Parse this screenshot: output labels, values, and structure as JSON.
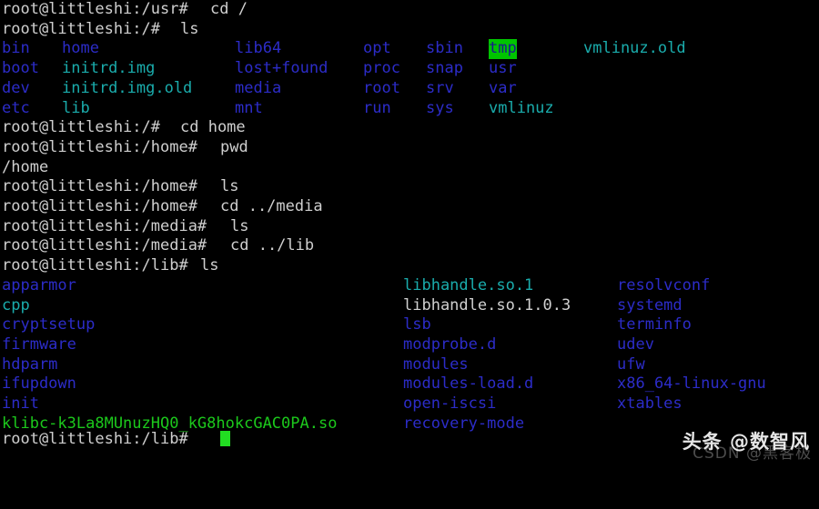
{
  "terminal": {
    "hostname": "littleshi",
    "user": "root",
    "background_color": "#000000",
    "palette": {
      "default": "#cfcfcf",
      "white_file": "#d0d0d0",
      "blue_dir": "#2c2cc8",
      "cyan_symlink": "#1aacac",
      "green_exec": "#1cc81c",
      "sticky_bg": "#00c400",
      "sticky_fg": "#1a1a8c",
      "cursor": "#22dd22"
    },
    "lines": [
      {
        "type": "prompt",
        "prompt": "root@littleshi:/usr# ",
        "command": "cd /"
      },
      {
        "type": "prompt",
        "prompt": "root@littleshi:/# ",
        "command": "ls"
      }
    ],
    "root_listing_rows": [
      [
        {
          "text": "bin",
          "color": "blue"
        },
        {
          "text": "home",
          "color": "blue"
        },
        {
          "text": "lib64",
          "color": "blue"
        },
        {
          "text": "opt",
          "color": "blue"
        },
        {
          "text": "sbin",
          "color": "blue"
        },
        {
          "text": "tmp",
          "color": "sticky"
        },
        {
          "text": "vmlinuz.old",
          "color": "cyan"
        }
      ],
      [
        {
          "text": "boot",
          "color": "blue"
        },
        {
          "text": "initrd.img",
          "color": "cyan"
        },
        {
          "text": "lost+found",
          "color": "blue"
        },
        {
          "text": "proc",
          "color": "blue"
        },
        {
          "text": "snap",
          "color": "blue"
        },
        {
          "text": "usr",
          "color": "blue"
        },
        {
          "text": "",
          "color": "blue"
        }
      ],
      [
        {
          "text": "dev",
          "color": "blue"
        },
        {
          "text": "initrd.img.old",
          "color": "cyan"
        },
        {
          "text": "media",
          "color": "blue"
        },
        {
          "text": "root",
          "color": "blue"
        },
        {
          "text": "srv",
          "color": "blue"
        },
        {
          "text": "var",
          "color": "blue"
        },
        {
          "text": "",
          "color": "blue"
        }
      ],
      [
        {
          "text": "etc",
          "color": "blue"
        },
        {
          "text": "lib",
          "color": "cyan"
        },
        {
          "text": "mnt",
          "color": "blue"
        },
        {
          "text": "run",
          "color": "blue"
        },
        {
          "text": "sys",
          "color": "blue"
        },
        {
          "text": "vmlinuz",
          "color": "cyan"
        },
        {
          "text": "",
          "color": "blue"
        }
      ]
    ],
    "middle_lines": [
      {
        "type": "prompt",
        "prompt": "root@littleshi:/# ",
        "command": "cd home"
      },
      {
        "type": "prompt",
        "prompt": "root@littleshi:/home# ",
        "command": "pwd"
      },
      {
        "type": "output",
        "text": "/home"
      },
      {
        "type": "prompt",
        "prompt": "root@littleshi:/home# ",
        "command": "ls"
      },
      {
        "type": "prompt",
        "prompt": "root@littleshi:/home# ",
        "command": "cd ../media"
      },
      {
        "type": "prompt",
        "prompt": "root@littleshi:/media# ",
        "command": "ls"
      },
      {
        "type": "prompt",
        "prompt": "root@littleshi:/media# ",
        "command": "cd ../lib"
      },
      {
        "type": "prompt",
        "prompt": "root@littleshi:/lib# ",
        "command": "ls"
      }
    ],
    "lib_listing_rows": [
      [
        {
          "text": "apparmor",
          "color": "blue"
        },
        {
          "text": "libhandle.so.1",
          "color": "cyan"
        },
        {
          "text": "resolvconf",
          "color": "blue"
        }
      ],
      [
        {
          "text": "cpp",
          "color": "cyan"
        },
        {
          "text": "libhandle.so.1.0.3",
          "color": "white"
        },
        {
          "text": "systemd",
          "color": "blue"
        }
      ],
      [
        {
          "text": "cryptsetup",
          "color": "blue"
        },
        {
          "text": "lsb",
          "color": "blue"
        },
        {
          "text": "terminfo",
          "color": "blue"
        }
      ],
      [
        {
          "text": "firmware",
          "color": "blue"
        },
        {
          "text": "modprobe.d",
          "color": "blue"
        },
        {
          "text": "udev",
          "color": "blue"
        }
      ],
      [
        {
          "text": "hdparm",
          "color": "blue"
        },
        {
          "text": "modules",
          "color": "blue"
        },
        {
          "text": "ufw",
          "color": "blue"
        }
      ],
      [
        {
          "text": "ifupdown",
          "color": "blue"
        },
        {
          "text": "modules-load.d",
          "color": "blue"
        },
        {
          "text": "x86_64-linux-gnu",
          "color": "blue"
        }
      ],
      [
        {
          "text": "init",
          "color": "blue"
        },
        {
          "text": "open-iscsi",
          "color": "blue"
        },
        {
          "text": "xtables",
          "color": "blue"
        }
      ],
      [
        {
          "text": "klibc-k3La8MUnuzHQ0_kG8hokcGAC0PA.so",
          "color": "green"
        },
        {
          "text": "recovery-mode",
          "color": "blue"
        },
        {
          "text": "",
          "color": "blue"
        }
      ]
    ],
    "final_line": {
      "prompt": "root@littleshi:/lib# ",
      "cursor": "block"
    }
  },
  "watermarks": {
    "toutiao": "头条 @数智风",
    "csdn": "CSDN @黑客极"
  }
}
